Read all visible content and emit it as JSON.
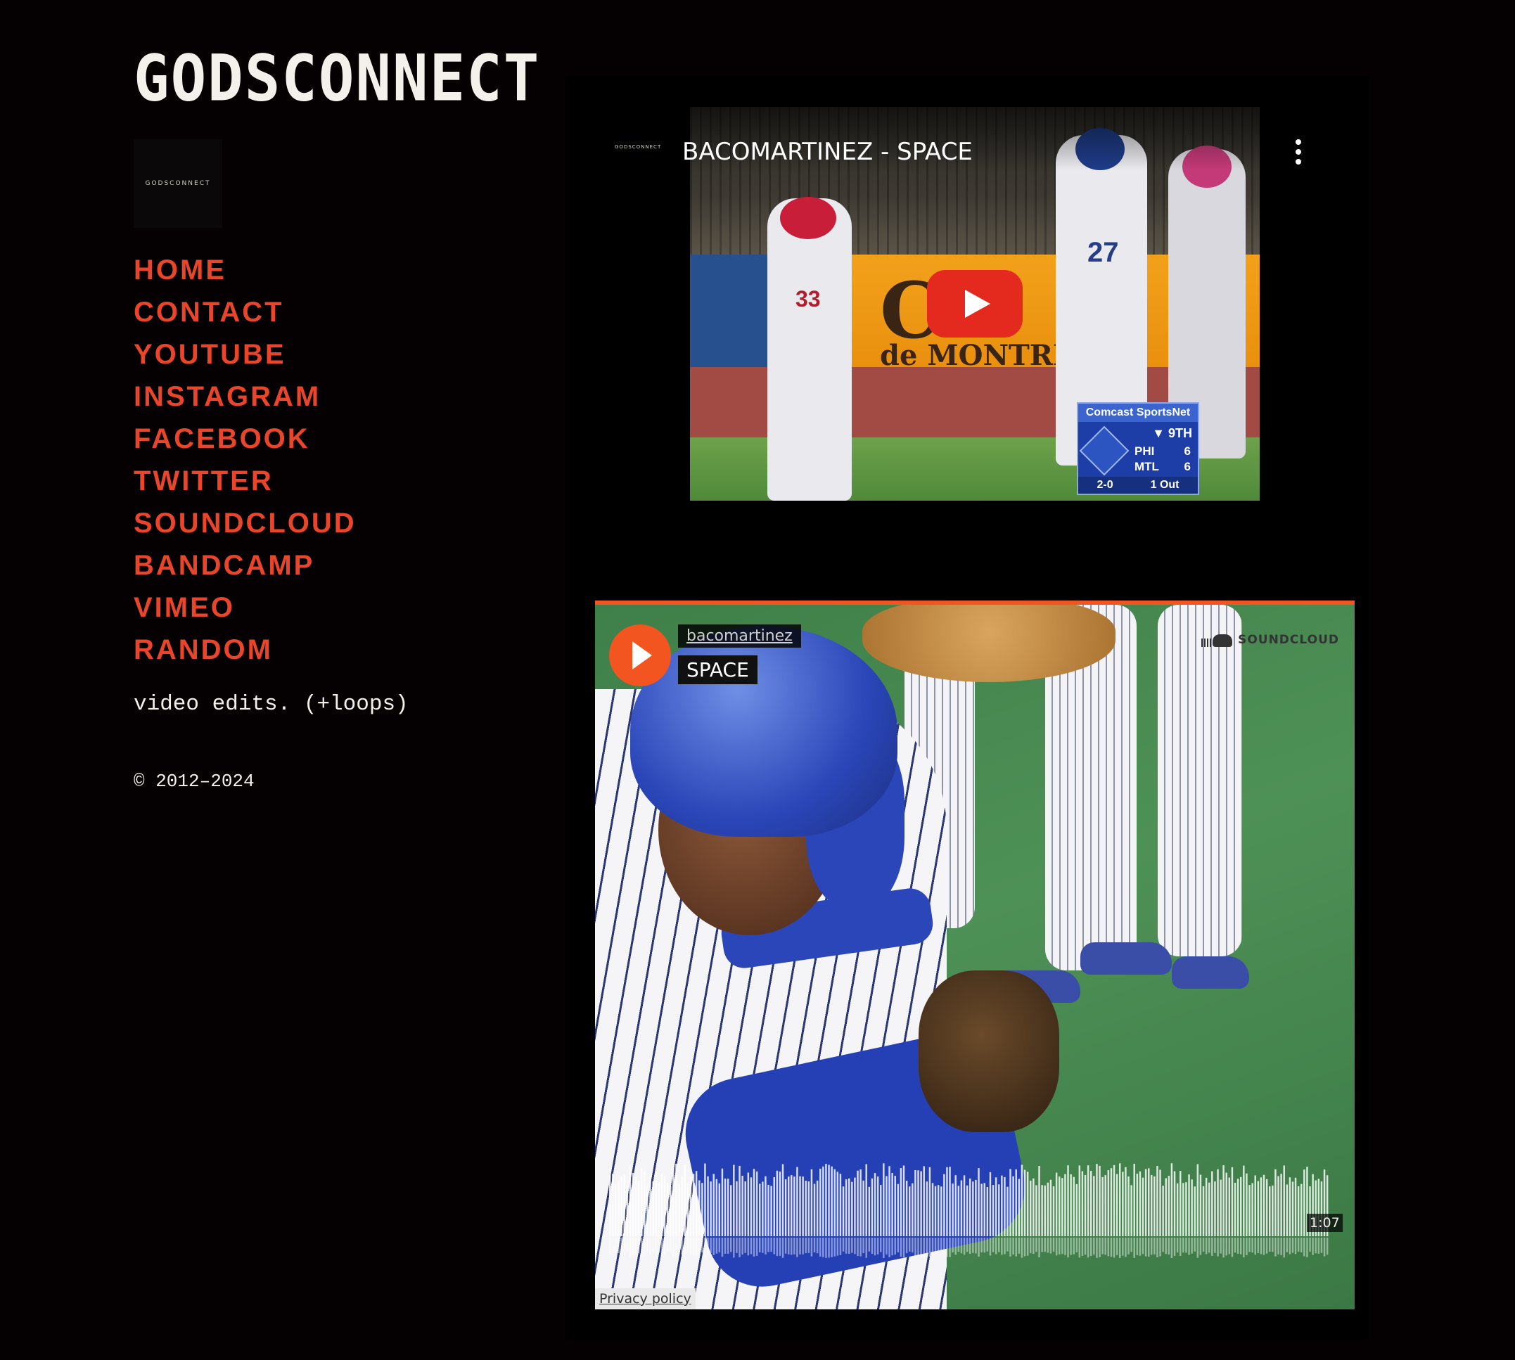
{
  "site": {
    "title": "GODSCONNECT",
    "logo_text": "GODSCONNECT",
    "tagline": "video edits. (+loops)",
    "copyright": "© 2012–2024"
  },
  "nav": [
    {
      "label": "HOME"
    },
    {
      "label": "CONTACT"
    },
    {
      "label": "YOUTUBE"
    },
    {
      "label": "INSTAGRAM"
    },
    {
      "label": "FACEBOOK"
    },
    {
      "label": "TWITTER"
    },
    {
      "label": "SOUNDCLOUD"
    },
    {
      "label": "BANDCAMP"
    },
    {
      "label": "VIMEO"
    },
    {
      "label": "RANDOM"
    }
  ],
  "youtube_embed": {
    "channel_logo_text": "GODSCONNECT",
    "video_title": "BACOMARTINEZ - SPACE",
    "menu_icon": "more-vertical-icon",
    "play_icon": "youtube-play-icon",
    "thumbnail": {
      "banner_text": "C",
      "banner_subtext": "de MONTREAL",
      "jersey_numbers": [
        "33",
        "27"
      ],
      "scorebug": {
        "network": "Comcast SportsNet",
        "inning": "9TH",
        "teams": [
          {
            "team": "PHI",
            "score": "6"
          },
          {
            "team": "MTL",
            "score": "6"
          }
        ],
        "count": "2-0",
        "outs": "1 Out"
      }
    }
  },
  "soundcloud_embed": {
    "artist": "bacomartinez",
    "track": "SPACE",
    "brand": "SOUNDCLOUD",
    "duration": "1:07",
    "privacy_link": "Privacy policy",
    "play_icon": "play-icon",
    "brand_icon": "soundcloud-icon",
    "played_fraction": 0
  },
  "colors": {
    "background": "#050102",
    "nav_accent": "#e8452a",
    "title": "#f4f1ec",
    "soundcloud_orange": "#f2551f",
    "youtube_red": "#e42a1f"
  }
}
